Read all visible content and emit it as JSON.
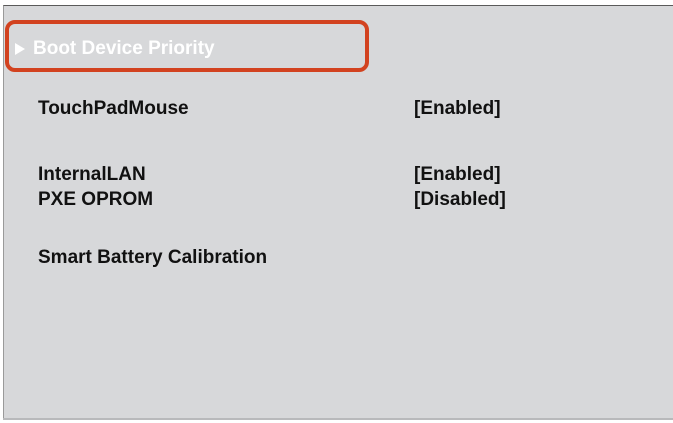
{
  "menu": {
    "boot_device_priority": "Boot Device Priority",
    "items": [
      {
        "label": "TouchPadMouse",
        "value": "[Enabled]"
      },
      {
        "label": "InternalLAN",
        "value": "[Enabled]"
      },
      {
        "label": "PXE OPROM",
        "value": "[Disabled]"
      },
      {
        "label": "Smart Battery Calibration",
        "value": ""
      }
    ]
  },
  "colors": {
    "background": "#d7d8da",
    "highlight_outline": "#d2421f",
    "text": "#111111",
    "selected_text": "#ffffff"
  }
}
